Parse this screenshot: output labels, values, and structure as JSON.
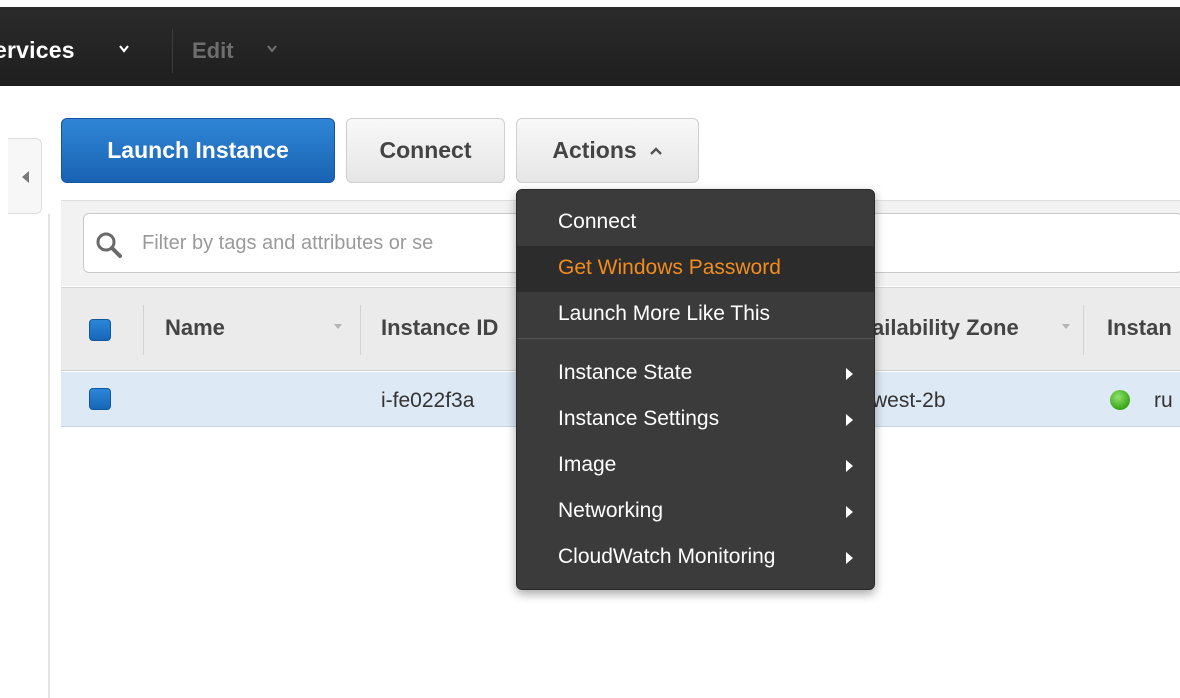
{
  "topnav": {
    "services_label": "ervices",
    "edit_label": "Edit"
  },
  "toolbar": {
    "launch_label": "Launch Instance",
    "connect_label": "Connect",
    "actions_label": "Actions"
  },
  "filter": {
    "placeholder": "Filter by tags and attributes or se"
  },
  "table": {
    "headers": [
      "Name",
      "Instance ID",
      "ailability Zone",
      "Instan"
    ],
    "rows": [
      {
        "name": "",
        "instance_id": "i-fe022f3a",
        "zone": "west-2b",
        "state": "ru"
      }
    ]
  },
  "actions_menu": {
    "items": [
      {
        "label": "Connect",
        "submenu": false
      },
      {
        "label": "Get Windows Password",
        "submenu": false,
        "highlighted": true
      },
      {
        "label": "Launch More Like This",
        "submenu": false
      },
      {
        "label": "Instance State",
        "submenu": true
      },
      {
        "label": "Instance Settings",
        "submenu": true
      },
      {
        "label": "Image",
        "submenu": true
      },
      {
        "label": "Networking",
        "submenu": true
      },
      {
        "label": "CloudWatch Monitoring",
        "submenu": true
      }
    ]
  },
  "colors": {
    "accent_blue": "#1f6fc5",
    "menu_highlight": "#f28c1c",
    "status_running": "#39a418"
  },
  "icons": [
    "chevron-down-icon",
    "chevron-up-icon",
    "search-icon",
    "collapse-left-icon",
    "submenu-arrow-icon",
    "status-running-icon"
  ]
}
